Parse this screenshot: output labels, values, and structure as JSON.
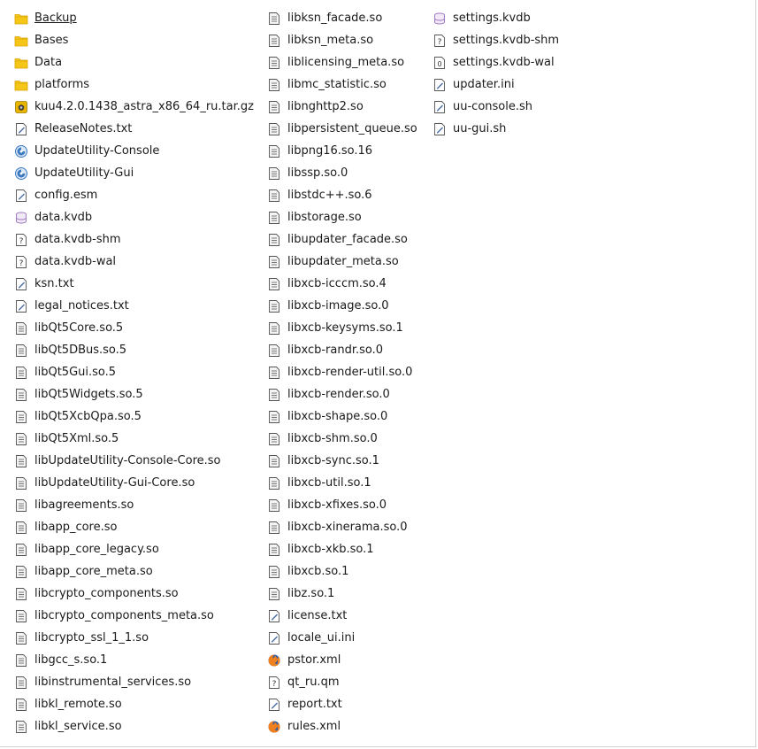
{
  "colors": {
    "folder": "#f5c518",
    "folder_dark": "#d9a400",
    "doc_line": "#4a6fa5",
    "db": "#a07cc0",
    "archive": "#e8b400",
    "exec": "#3a78c2",
    "firefox_orange": "#f07f1e",
    "firefox_blue": "#2d5ea8"
  },
  "columns": [
    {
      "items": [
        {
          "name": "Backup",
          "icon": "folder-icon",
          "underline": true
        },
        {
          "name": "Bases",
          "icon": "folder-icon"
        },
        {
          "name": "Data",
          "icon": "folder-icon"
        },
        {
          "name": "platforms",
          "icon": "folder-icon"
        },
        {
          "name": "kuu4.2.0.1438_astra_x86_64_ru.tar.gz",
          "icon": "archive-icon"
        },
        {
          "name": "ReleaseNotes.txt",
          "icon": "text-file-icon"
        },
        {
          "name": "UpdateUtility-Console",
          "icon": "executable-icon"
        },
        {
          "name": "UpdateUtility-Gui",
          "icon": "executable-icon"
        },
        {
          "name": "config.esm",
          "icon": "text-file-icon"
        },
        {
          "name": "data.kvdb",
          "icon": "database-icon"
        },
        {
          "name": "data.kvdb-shm",
          "icon": "unknown-file-icon"
        },
        {
          "name": "data.kvdb-wal",
          "icon": "unknown-file-icon"
        },
        {
          "name": "ksn.txt",
          "icon": "text-file-icon"
        },
        {
          "name": "legal_notices.txt",
          "icon": "text-file-icon"
        },
        {
          "name": "libQt5Core.so.5",
          "icon": "library-icon"
        },
        {
          "name": "libQt5DBus.so.5",
          "icon": "library-icon"
        },
        {
          "name": "libQt5Gui.so.5",
          "icon": "library-icon"
        },
        {
          "name": "libQt5Widgets.so.5",
          "icon": "library-icon"
        },
        {
          "name": "libQt5XcbQpa.so.5",
          "icon": "library-icon"
        },
        {
          "name": "libQt5Xml.so.5",
          "icon": "library-icon"
        },
        {
          "name": "libUpdateUtility-Console-Core.so",
          "icon": "library-icon"
        },
        {
          "name": "libUpdateUtility-Gui-Core.so",
          "icon": "library-icon"
        },
        {
          "name": "libagreements.so",
          "icon": "library-icon"
        },
        {
          "name": "libapp_core.so",
          "icon": "library-icon"
        },
        {
          "name": "libapp_core_legacy.so",
          "icon": "library-icon"
        },
        {
          "name": "libapp_core_meta.so",
          "icon": "library-icon"
        },
        {
          "name": "libcrypto_components.so",
          "icon": "library-icon"
        },
        {
          "name": "libcrypto_components_meta.so",
          "icon": "library-icon"
        },
        {
          "name": "libcrypto_ssl_1_1.so",
          "icon": "library-icon"
        },
        {
          "name": "libgcc_s.so.1",
          "icon": "library-icon"
        },
        {
          "name": "libinstrumental_services.so",
          "icon": "library-icon"
        },
        {
          "name": "libkl_remote.so",
          "icon": "library-icon"
        },
        {
          "name": "libkl_service.so",
          "icon": "library-icon"
        }
      ]
    },
    {
      "items": [
        {
          "name": "libksn_facade.so",
          "icon": "library-icon"
        },
        {
          "name": "libksn_meta.so",
          "icon": "library-icon"
        },
        {
          "name": "liblicensing_meta.so",
          "icon": "library-icon"
        },
        {
          "name": "libmc_statistic.so",
          "icon": "library-icon"
        },
        {
          "name": "libnghttp2.so",
          "icon": "library-icon"
        },
        {
          "name": "libpersistent_queue.so",
          "icon": "library-icon"
        },
        {
          "name": "libpng16.so.16",
          "icon": "library-icon"
        },
        {
          "name": "libssp.so.0",
          "icon": "library-icon"
        },
        {
          "name": "libstdc++.so.6",
          "icon": "library-icon"
        },
        {
          "name": "libstorage.so",
          "icon": "library-icon"
        },
        {
          "name": "libupdater_facade.so",
          "icon": "library-icon"
        },
        {
          "name": "libupdater_meta.so",
          "icon": "library-icon"
        },
        {
          "name": "libxcb-icccm.so.4",
          "icon": "library-icon"
        },
        {
          "name": "libxcb-image.so.0",
          "icon": "library-icon"
        },
        {
          "name": "libxcb-keysyms.so.1",
          "icon": "library-icon"
        },
        {
          "name": "libxcb-randr.so.0",
          "icon": "library-icon"
        },
        {
          "name": "libxcb-render-util.so.0",
          "icon": "library-icon"
        },
        {
          "name": "libxcb-render.so.0",
          "icon": "library-icon"
        },
        {
          "name": "libxcb-shape.so.0",
          "icon": "library-icon"
        },
        {
          "name": "libxcb-shm.so.0",
          "icon": "library-icon"
        },
        {
          "name": "libxcb-sync.so.1",
          "icon": "library-icon"
        },
        {
          "name": "libxcb-util.so.1",
          "icon": "library-icon"
        },
        {
          "name": "libxcb-xfixes.so.0",
          "icon": "library-icon"
        },
        {
          "name": "libxcb-xinerama.so.0",
          "icon": "library-icon"
        },
        {
          "name": "libxcb-xkb.so.1",
          "icon": "library-icon"
        },
        {
          "name": "libxcb.so.1",
          "icon": "library-icon"
        },
        {
          "name": "libz.so.1",
          "icon": "library-icon"
        },
        {
          "name": "license.txt",
          "icon": "text-file-icon"
        },
        {
          "name": "locale_ui.ini",
          "icon": "text-file-icon"
        },
        {
          "name": "pstor.xml",
          "icon": "firefox-icon"
        },
        {
          "name": "qt_ru.qm",
          "icon": "unknown-file-icon"
        },
        {
          "name": "report.txt",
          "icon": "text-file-icon"
        },
        {
          "name": "rules.xml",
          "icon": "firefox-icon"
        }
      ]
    },
    {
      "items": [
        {
          "name": "settings.kvdb",
          "icon": "database-icon"
        },
        {
          "name": "settings.kvdb-shm",
          "icon": "unknown-file-icon"
        },
        {
          "name": "settings.kvdb-wal",
          "icon": "binary-file-icon"
        },
        {
          "name": "updater.ini",
          "icon": "text-file-icon"
        },
        {
          "name": "uu-console.sh",
          "icon": "text-file-icon"
        },
        {
          "name": "uu-gui.sh",
          "icon": "text-file-icon"
        }
      ]
    }
  ]
}
